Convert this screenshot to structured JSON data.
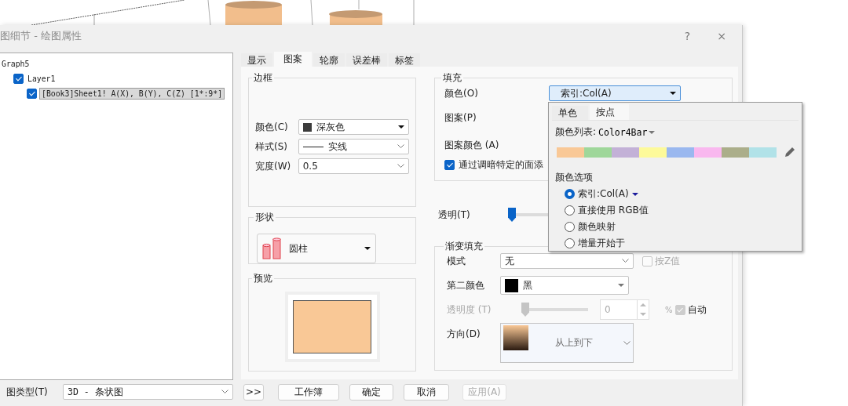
{
  "window": {
    "title": "图细节 - 绘图属性",
    "help_button": "?",
    "close_button": "×"
  },
  "tree": [
    {
      "label": "Graph5",
      "selected": false,
      "children": [
        {
          "label": "Layer1",
          "checked": true,
          "selected": false,
          "children": [
            {
              "label": "[Book3]Sheet1! A(X), B(Y), C(Z) [1*:9*]",
              "checked": true,
              "selected": true
            }
          ]
        }
      ]
    }
  ],
  "tabs": [
    {
      "label": "显示",
      "selected": false
    },
    {
      "label": "图案",
      "selected": true
    },
    {
      "label": "轮廓",
      "selected": false
    },
    {
      "label": "误差棒",
      "selected": false
    },
    {
      "label": "标签",
      "selected": false
    }
  ],
  "border_group": {
    "title": "边框",
    "fields": [
      {
        "label": "颜色(C)",
        "value": "深灰色",
        "kind": "color"
      },
      {
        "label": "样式(S)",
        "value": "实线",
        "kind": "line"
      },
      {
        "label": "宽度(W)",
        "value": "0.5",
        "kind": "combo"
      }
    ]
  },
  "shape_group": {
    "title": "形状",
    "value": "圆柱"
  },
  "preview_group": {
    "title": "预览"
  },
  "fill_group": {
    "title": "填充",
    "color_label": "颜色(O)",
    "color_value": "索引:Col(A)",
    "pattern_label": "图案(P)",
    "pattern_color_label": "图案颜色 (A)",
    "shade_checkbox": {
      "label": "通过调暗特定的面添",
      "checked": true
    }
  },
  "transparency": {
    "label": "透明(T)",
    "level": 0
  },
  "gradient_group": {
    "title": "渐变填充",
    "mode_label": "模式",
    "mode_value": "无",
    "by_z": {
      "label": "按Z值",
      "checked": false,
      "disabled": true
    },
    "second_color_label": "第二颜色",
    "second_color_value": "黑",
    "opacity": {
      "label": "透明度 (T)",
      "level": 0,
      "value": "0",
      "unit": "%",
      "disabled": true
    },
    "auto": {
      "label": "自动",
      "checked": true,
      "disabled": true
    },
    "direction_label": "方向(D)",
    "direction_value": "从上到下"
  },
  "bottom_bar": {
    "plot_type_label": "图类型(T)",
    "plot_type_value": "3D - 条状图",
    "buttons": [
      {
        "label": ">>",
        "disabled": false
      },
      {
        "label": "工作簿",
        "disabled": false
      },
      {
        "label": "确定",
        "disabled": false
      },
      {
        "label": "取消",
        "disabled": false
      },
      {
        "label": "应用(A)",
        "disabled": true
      }
    ]
  },
  "color_popup": {
    "tabs": [
      {
        "label": "单色",
        "selected": false
      },
      {
        "label": "按点",
        "selected": true
      }
    ],
    "list_label": "颜色列表:",
    "list_value": "Color4Bar",
    "palette": [
      {
        "color": "#f9c896"
      },
      {
        "color": "#9fd79a"
      },
      {
        "color": "#c3b1d7"
      },
      {
        "color": "#fdfa9a"
      },
      {
        "color": "#9ab8ef"
      },
      {
        "color": "#f9b8ef"
      },
      {
        "color": "#abae8a"
      },
      {
        "color": "#b1e2e8"
      }
    ],
    "options_title": "颜色选项",
    "options": [
      {
        "label": "索引:Col(A)",
        "selected": true,
        "dropdown": true
      },
      {
        "label": "直接使用 RGB值",
        "selected": false,
        "dropdown": false
      },
      {
        "label": "颜色映射",
        "selected": false,
        "dropdown": false
      },
      {
        "label": "增量开始于",
        "selected": false,
        "dropdown": false
      }
    ]
  }
}
